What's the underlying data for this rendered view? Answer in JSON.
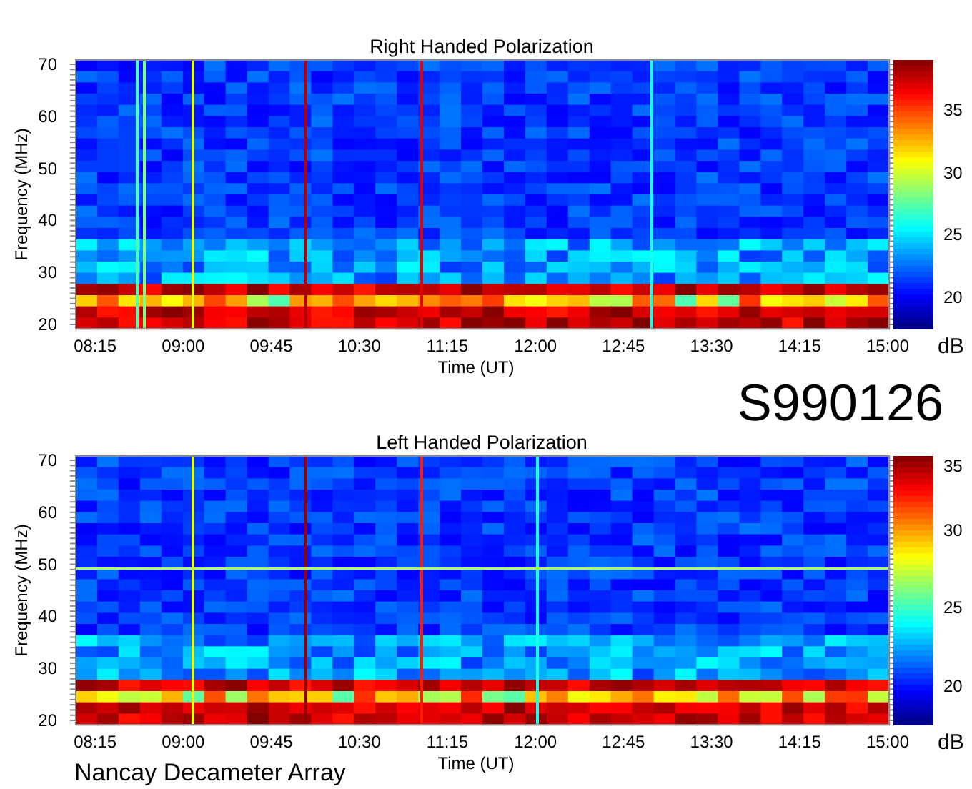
{
  "panels": [
    {
      "title": "Right Handed Polarization",
      "ylabel": "Frequency (MHz)",
      "yticks": [
        "70",
        "60",
        "50",
        "40",
        "30",
        "20"
      ],
      "xticks": [
        "08:15",
        "09:00",
        "09:45",
        "10:30",
        "11:15",
        "12:00",
        "12:45",
        "13:30",
        "14:15",
        "15:00"
      ],
      "xlabel": "Time (UT)",
      "colorbar": {
        "unit": "dB",
        "ticks": [
          "35",
          "30",
          "25",
          "20"
        ]
      }
    },
    {
      "title": "Left Handed Polarization",
      "ylabel": "Frequency (MHz)",
      "yticks": [
        "70",
        "60",
        "50",
        "40",
        "30",
        "20"
      ],
      "xticks": [
        "08:15",
        "09:00",
        "09:45",
        "10:30",
        "11:15",
        "12:00",
        "12:45",
        "13:30",
        "14:15",
        "15:00"
      ],
      "xlabel": "Time (UT)",
      "colorbar": {
        "unit": "dB",
        "ticks": [
          "35",
          "30",
          "25",
          "20"
        ]
      }
    }
  ],
  "figure_label": "S990126",
  "footer": "Nancay Decameter Array"
}
